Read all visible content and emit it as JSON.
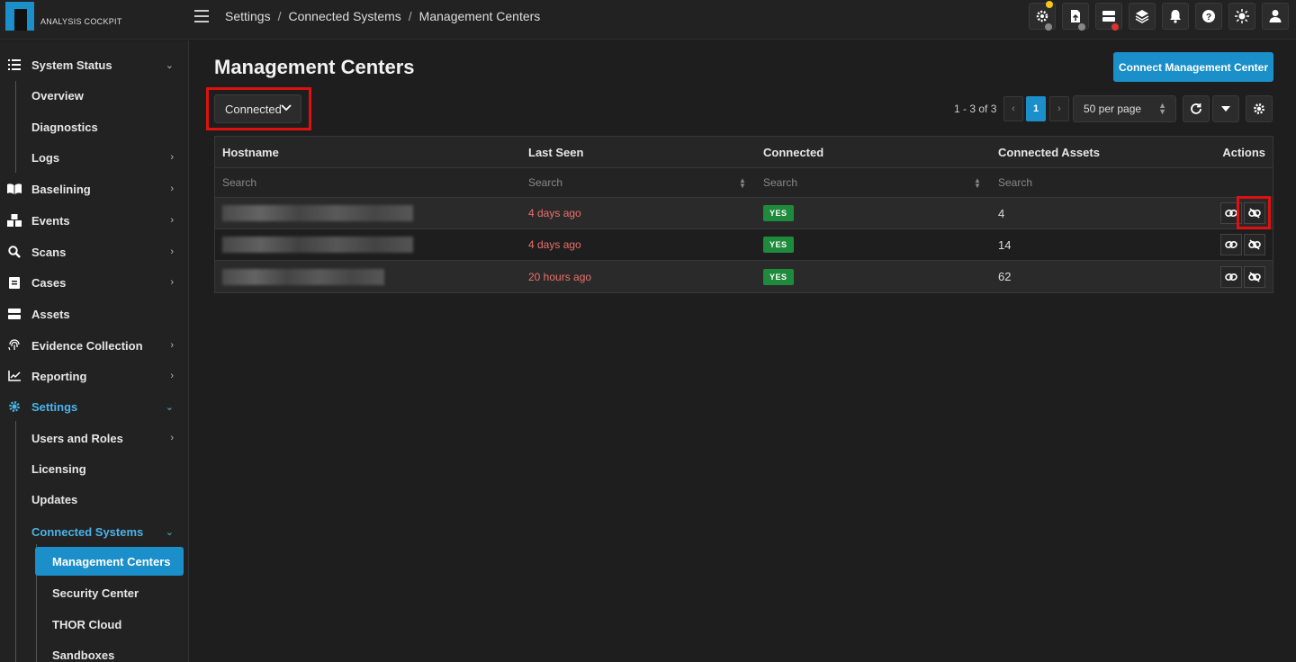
{
  "app": {
    "logo_text": "ANALYSIS COCKPIT"
  },
  "breadcrumb": {
    "items": [
      "Settings",
      "Connected Systems",
      "Management Centers"
    ],
    "separator": "/"
  },
  "top_icons": [
    "settings-gear-icon",
    "upload-icon",
    "server-icon",
    "layers-icon",
    "bell-icon",
    "help-icon",
    "theme-sun-icon",
    "user-icon"
  ],
  "sidebar": {
    "system_status": "System Status",
    "overview": "Overview",
    "diagnostics": "Diagnostics",
    "logs": "Logs",
    "baselining": "Baselining",
    "events": "Events",
    "scans": "Scans",
    "cases": "Cases",
    "assets": "Assets",
    "evidence_collection": "Evidence Collection",
    "reporting": "Reporting",
    "settings": "Settings",
    "users_roles": "Users and Roles",
    "licensing": "Licensing",
    "updates": "Updates",
    "connected_systems": "Connected Systems",
    "management_centers": "Management Centers",
    "security_center": "Security Center",
    "thor_cloud": "THOR Cloud",
    "sandboxes": "Sandboxes"
  },
  "main": {
    "title": "Management Centers",
    "connect_button": "Connect Management Center",
    "filter_value": "Connected",
    "pager": {
      "range": "1 - 3 of 3",
      "page": "1",
      "per_page": "50 per page"
    }
  },
  "table": {
    "headers": {
      "hostname": "Hostname",
      "last_seen": "Last Seen",
      "connected": "Connected",
      "assets": "Connected Assets",
      "actions": "Actions"
    },
    "search_placeholder": "Search",
    "rows": [
      {
        "last_seen": "4 days ago",
        "connected": "YES",
        "assets": "4"
      },
      {
        "last_seen": "4 days ago",
        "connected": "YES",
        "assets": "14"
      },
      {
        "last_seen": "20 hours ago",
        "connected": "YES",
        "assets": "62"
      }
    ]
  },
  "colors": {
    "accent": "#1a8fc9",
    "status_yes": "#1e8a3c",
    "time_red": "#e9706a",
    "highlight": "#dd1111"
  }
}
